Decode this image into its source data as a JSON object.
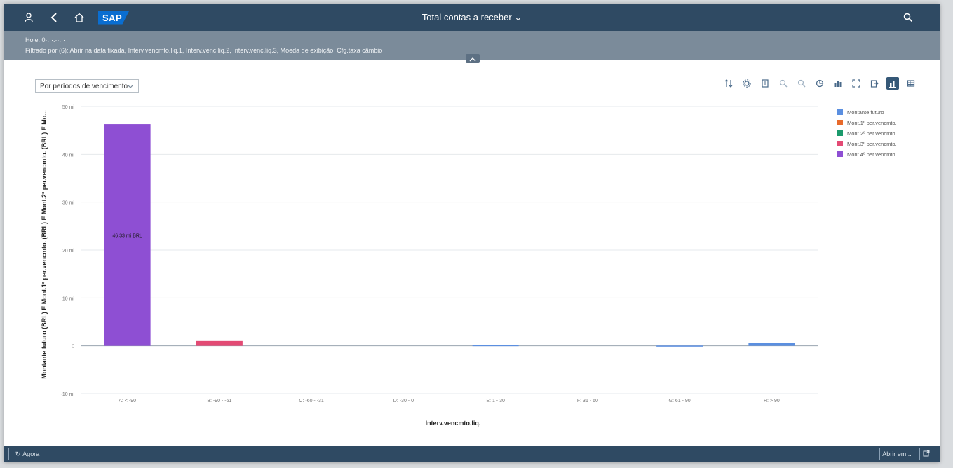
{
  "shell": {
    "title": "Total contas a receber",
    "logo": "SAP",
    "icons": [
      "user-icon",
      "back-icon",
      "home-icon",
      "search-icon"
    ]
  },
  "header": {
    "today": "Hoje: 0·:··:··:··",
    "filters": "Filtrado por (6): Abrir na data fixada, Interv.vencmto.liq.1, Interv.venc.liq.2, Interv.venc.liq.3, Moeda de exibição, Cfg.taxa câmbio"
  },
  "toolbar": {
    "select_value": "Por períodos de vencimento"
  },
  "colors": {
    "shell": "#2f4a63",
    "header": "#7b8b9a",
    "series": [
      "#5b8fe0",
      "#e86a2b",
      "#1b9a6c",
      "#e34a74",
      "#8e4fd3"
    ]
  },
  "chart_data": {
    "type": "bar",
    "stacked": true,
    "categories": [
      "A: < -90",
      "B: -90 - -61",
      "C: -60 - -31",
      "D: -30 - 0",
      "E: 1 - 30",
      "F: 31 - 60",
      "G: 61 - 90",
      "H: > 90"
    ],
    "series": [
      {
        "name": "Montante futuro",
        "values": [
          0,
          0,
          0,
          0,
          0.15,
          0,
          0.05,
          0.55
        ]
      },
      {
        "name": "Mont.1º per.vencmto.",
        "values": [
          0,
          0,
          0,
          0,
          0,
          0,
          0,
          0
        ]
      },
      {
        "name": "Mont.2º per.vencmto.",
        "values": [
          0,
          0,
          0,
          0,
          0,
          0,
          0,
          0
        ]
      },
      {
        "name": "Mont.3º per.vencmto.",
        "values": [
          0,
          1.0,
          0,
          0,
          0,
          0,
          0,
          0
        ]
      },
      {
        "name": "Mont.4º per.vencmto.",
        "values": [
          46.33,
          0,
          0,
          0,
          0,
          0,
          0,
          0
        ]
      }
    ],
    "data_labels": [
      "46,33 mi BRL"
    ],
    "yticks": [
      "-10 mi",
      "0",
      "10 mi",
      "20 mi",
      "30 mi",
      "40 mi",
      "50 mi"
    ],
    "ylim": [
      -10,
      50
    ],
    "ylabel": "Montante futuro (BRL) E Mont.1º per.vencmto. (BRL) E Mont.2º per.vencmto. (BRL) E Mo...",
    "xlabel": "Interv.vencmto.liq.",
    "legend_position": "right",
    "grid": true
  },
  "footer": {
    "left_button": "Agora",
    "right_button": "Abrir em..."
  }
}
